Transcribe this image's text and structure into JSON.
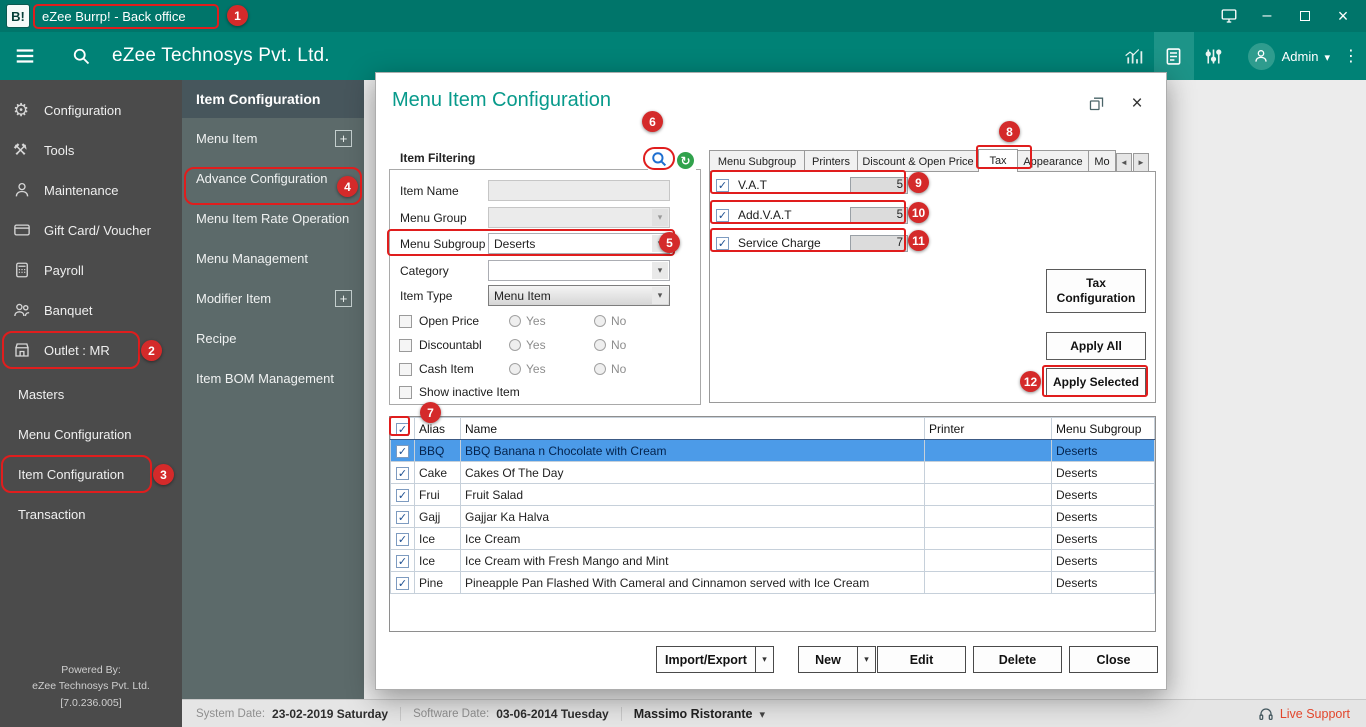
{
  "titlebar": {
    "logo_text": "B!",
    "title": "eZee Burrp! - Back office"
  },
  "header": {
    "company_name": "eZee Technosys Pvt. Ltd.",
    "user_name": "Admin"
  },
  "sidebar": {
    "items": [
      {
        "label": "Configuration"
      },
      {
        "label": "Tools"
      },
      {
        "label": "Maintenance"
      },
      {
        "label": "Gift Card/ Voucher"
      },
      {
        "label": "Payroll"
      },
      {
        "label": "Banquet"
      },
      {
        "label": "Outlet : MR"
      },
      {
        "label": "Masters"
      },
      {
        "label": "Menu Configuration"
      },
      {
        "label": "Item Configuration"
      },
      {
        "label": "Transaction"
      }
    ],
    "footer_lines": [
      "Powered By:",
      "eZee Technosys Pvt. Ltd.",
      "[7.0.236.005]"
    ]
  },
  "submenu": {
    "title": "Item Configuration",
    "add_button_label": "+",
    "items": [
      {
        "label": "Menu Item"
      },
      {
        "label": "Advance Configuration"
      },
      {
        "label": "Menu Item Rate Operation"
      },
      {
        "label": "Menu Management"
      },
      {
        "label": "Modifier Item"
      },
      {
        "label": "Recipe"
      },
      {
        "label": "Item BOM Management"
      }
    ]
  },
  "dialog": {
    "title": "Menu Item Configuration",
    "filter": {
      "group_title": "Item Filtering",
      "item_name_label": "Item Name",
      "item_name_value": "",
      "menu_group_label": "Menu Group",
      "menu_group_value": "",
      "menu_subgroup_label": "Menu Subgroup",
      "menu_subgroup_value": "Deserts",
      "category_label": "Category",
      "category_value": "",
      "item_type_label": "Item Type",
      "item_type_value": "Menu Item",
      "checkbox_rows": [
        {
          "label": "Open Price",
          "yes": "Yes",
          "no": "No"
        },
        {
          "label": "Discountabl",
          "yes": "Yes",
          "no": "No"
        },
        {
          "label": "Cash Item",
          "yes": "Yes",
          "no": "No"
        }
      ],
      "show_inactive_label": "Show inactive Item"
    },
    "tabs": [
      {
        "label": "Menu Subgroup"
      },
      {
        "label": "Printers"
      },
      {
        "label": "Discount & Open Price"
      },
      {
        "label": "Tax"
      },
      {
        "label": "Appearance"
      },
      {
        "label": "Mo"
      }
    ],
    "tax_panel": {
      "rows": [
        {
          "label": "V.A.T",
          "value": "5"
        },
        {
          "label": "Add.V.A.T",
          "value": "5"
        },
        {
          "label": "Service Charge",
          "value": "7"
        }
      ],
      "tax_config_button": "Tax Configuration",
      "apply_all_button": "Apply All",
      "apply_selected_button": "Apply Selected"
    },
    "table": {
      "columns": [
        "Alias",
        "Name",
        "Printer",
        "Menu Subgroup"
      ],
      "rows": [
        {
          "alias": "BBQ",
          "name": "BBQ Banana n Chocolate with Cream",
          "printer": "",
          "menu_subgroup": "Deserts"
        },
        {
          "alias": "Cake",
          "name": "Cakes Of The Day",
          "printer": "",
          "menu_subgroup": "Deserts"
        },
        {
          "alias": "Frui",
          "name": "Fruit Salad",
          "printer": "",
          "menu_subgroup": "Deserts"
        },
        {
          "alias": "Gajj",
          "name": "Gajjar Ka Halva",
          "printer": "",
          "menu_subgroup": "Deserts"
        },
        {
          "alias": "Ice",
          "name": "Ice Cream",
          "printer": "",
          "menu_subgroup": "Deserts"
        },
        {
          "alias": "Ice",
          "name": "Ice Cream with Fresh Mango and Mint",
          "printer": "",
          "menu_subgroup": "Deserts"
        },
        {
          "alias": "Pine",
          "name": "Pineapple Pan Flashed With Cameral and Cinnamon served with Ice Cream",
          "printer": "",
          "menu_subgroup": "Deserts"
        }
      ]
    },
    "footer_buttons": {
      "import_export": "Import/Export",
      "new": "New",
      "edit": "Edit",
      "delete": "Delete",
      "close": "Close"
    }
  },
  "statusbar": {
    "system_date_label": "System Date:",
    "system_date_value": "23-02-2019 Saturday",
    "software_date_label": "Software Date:",
    "software_date_value": "03-06-2014 Tuesday",
    "outlet_name": "Massimo Ristorante",
    "live_support": "Live Support"
  },
  "annotations": [
    "1",
    "2",
    "3",
    "4",
    "5",
    "6",
    "7",
    "8",
    "9",
    "10",
    "11",
    "12"
  ]
}
